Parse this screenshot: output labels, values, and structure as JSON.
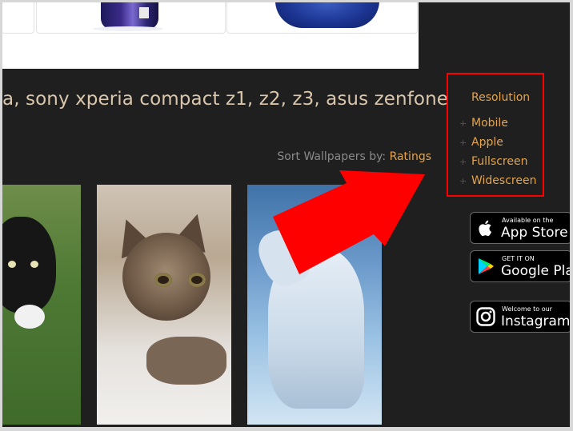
{
  "heading": "a, sony xperia compact z1, z2, z3, asus zenfone",
  "sort": {
    "label": "Sort Wallpapers by: ",
    "option": "Ratings"
  },
  "resolution": {
    "title": "Resolution",
    "bullet": "+",
    "items": [
      {
        "label": "Mobile"
      },
      {
        "label": "Apple"
      },
      {
        "label": "Fullscreen"
      },
      {
        "label": "Widescreen"
      }
    ]
  },
  "badges": {
    "appstore": {
      "small": "Available on the",
      "big": "App Store"
    },
    "googleplay": {
      "small": "GET IT ON",
      "big": "Google Play"
    },
    "instagram": {
      "small": "Welcome to our",
      "big": "Instagram"
    }
  },
  "colors": {
    "page_bg": "#1f1f1f",
    "accent_link": "#e5a44c",
    "heading_text": "#d9c6ac",
    "highlight_box": "#ff0000",
    "arrow": "#ff0000"
  },
  "thumbnails": [
    {
      "subject": "black-and-white-kitten-on-grass"
    },
    {
      "subject": "tabby-kitten-on-blanket"
    },
    {
      "subject": "howling-wolf-in-snow"
    }
  ]
}
